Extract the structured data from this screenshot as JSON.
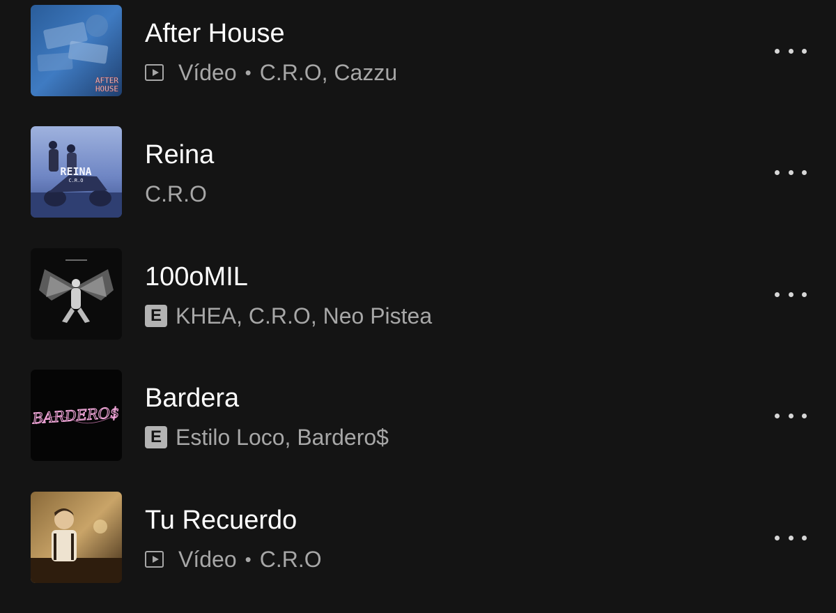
{
  "tracks": [
    {
      "title": "After House",
      "type": "Vídeo",
      "artists": "C.R.O, Cazzu",
      "explicit": false,
      "cover_text": [
        "AFTER",
        "HOUSE"
      ]
    },
    {
      "title": "Reina",
      "artists": "C.R.O",
      "explicit": false,
      "cover_text": [
        "REINA",
        "C.R.O"
      ]
    },
    {
      "title": "100oMIL",
      "artists": "KHEA, C.R.O, Neo Pistea",
      "explicit": true,
      "explicit_label": "E"
    },
    {
      "title": "Bardera",
      "artists": "Estilo Loco, Bardero$",
      "explicit": true,
      "explicit_label": "E",
      "cover_text": [
        "BARDERO$"
      ]
    },
    {
      "title": "Tu Recuerdo",
      "type": "Vídeo",
      "artists": "C.R.O",
      "explicit": false
    }
  ],
  "separator": "•",
  "icons": {
    "video": "video-icon",
    "explicit": "explicit-badge",
    "more": "more-options-icon"
  },
  "colors": {
    "background": "#141414",
    "title": "#ffffff",
    "subtitle": "#a7a7a7",
    "explicit_badge": "#b3b3b3"
  }
}
